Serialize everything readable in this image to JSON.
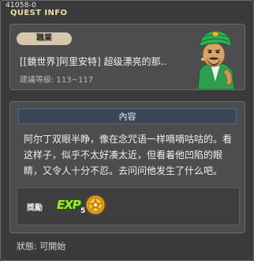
{
  "window": {
    "quest_id": "41058-0",
    "title": "QUEST INFO"
  },
  "quest": {
    "job_label": "職業",
    "name": "[[鏡世界]阿里安特] 超级漂亮的那..",
    "level_line": "建議等級: 113~117"
  },
  "content": {
    "section_title": "內容",
    "description": "阿尔丁双眼半睁，像在念咒语一样嘀嘀咕咕的。看这样子，似乎不太好凑太近，但看着他凹陷的眼睛，又令人十分不忍。去问问他发生了什么吧。"
  },
  "reward": {
    "label": "獎勵",
    "exp_label": "EXP",
    "exp_count": "5",
    "fame_icon": "fame-coin-icon"
  },
  "status": {
    "text": "狀態:  可開始"
  },
  "colors": {
    "window_bg": "#3a3a3c",
    "panel_bg": "#4d4d50",
    "title_color": "#e8e0a8",
    "section_header_bg": "#3a4756",
    "job_badge_bg": "#d8c7ad",
    "exp_green": "#9fe832",
    "coin_gold": "#e6a21f"
  }
}
